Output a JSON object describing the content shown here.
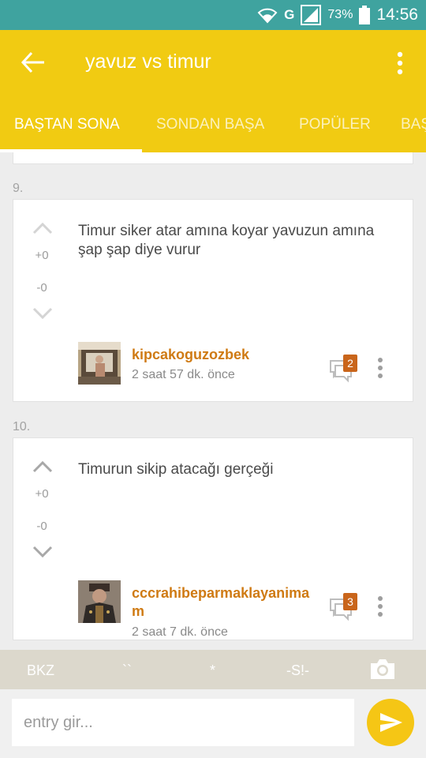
{
  "status_bar": {
    "network_type": "G",
    "battery": "73%",
    "time": "14:56"
  },
  "app_bar": {
    "title": "yavuz vs timur"
  },
  "tabs": [
    {
      "label": "BAŞTAN SONA",
      "active": true
    },
    {
      "label": "SONDAN BAŞA",
      "active": false
    },
    {
      "label": "POPÜLER",
      "active": false
    },
    {
      "label": "BAŞ",
      "active": false
    }
  ],
  "entries": [
    {
      "number": "9.",
      "text": "Timur siker atar amına koyar yavuzun amına şap şap diye vurur",
      "upvotes": "+0",
      "downvotes": "-0",
      "author": "kipcakoguzozbek",
      "time_ago": "2 saat 57 dk. önce",
      "comment_count": "2"
    },
    {
      "number": "10.",
      "text": "Timurun sikip atacağı gerçeği",
      "upvotes": "+0",
      "downvotes": "-0",
      "author": "cccrahibeparmaklayanimam",
      "time_ago": "2 saat 7 dk. önce",
      "comment_count": "3"
    }
  ],
  "shortcuts": [
    "BKZ",
    "``",
    "*",
    "-S!-"
  ],
  "composer": {
    "placeholder": "entry gir..."
  },
  "colors": {
    "status_bar": "#3fa39f",
    "app_bar": "#f1cb12",
    "author": "#cf7a13",
    "badge": "#c9651b",
    "send_button": "#f5c615"
  }
}
